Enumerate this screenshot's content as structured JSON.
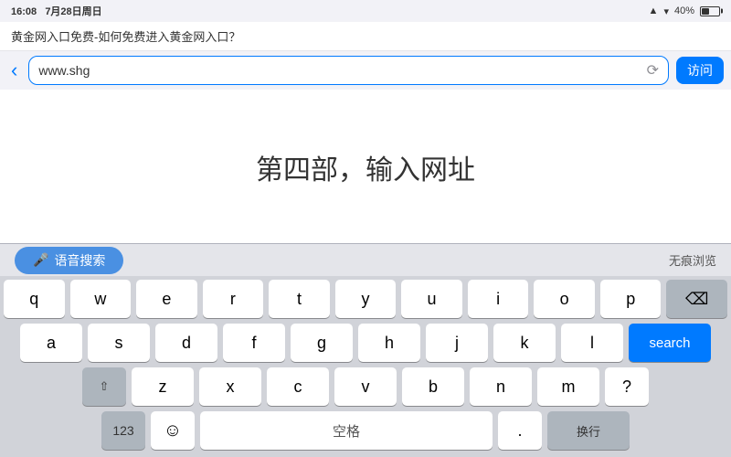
{
  "status": {
    "time": "16:08",
    "date": "7月28日周日",
    "battery": "40%",
    "battery_pct": 40
  },
  "nav": {
    "back_icon": "‹",
    "address": "www.shg",
    "reload_icon": "↺",
    "visit_label": "访问"
  },
  "page": {
    "title": "黄金网入口免费-如何免费进入黄金网入口？"
  },
  "main": {
    "instruction": "第四部，输入网址"
  },
  "toolbar": {
    "voice_search_label": "语音搜索",
    "private_label": "无痕浏览"
  },
  "keyboard": {
    "row1": [
      "q",
      "w",
      "e",
      "r",
      "t",
      "y",
      "u",
      "i",
      "o",
      "p"
    ],
    "row2": [
      "a",
      "s",
      "d",
      "f",
      "g",
      "h",
      "j",
      "k",
      "l"
    ],
    "row3": [
      "z",
      "x",
      "c",
      "v",
      "b",
      "n",
      "m"
    ],
    "space_label": "空格",
    "search_label": "search",
    "backspace": "⌫",
    "shift": "⇧",
    "num": "123",
    "emoji": "☺",
    "dot": ".",
    "question": "?"
  }
}
